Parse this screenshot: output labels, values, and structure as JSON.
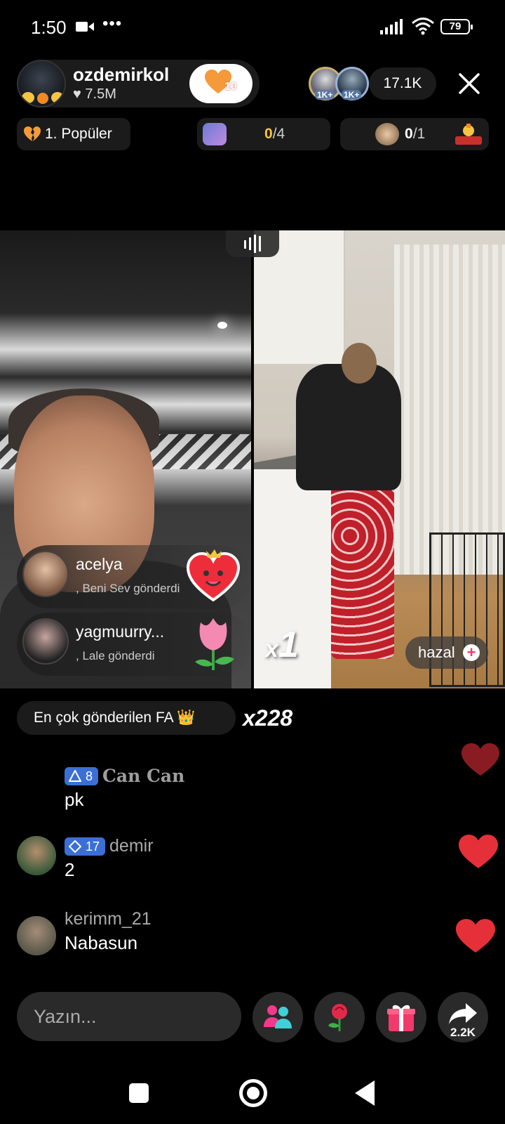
{
  "status_bar": {
    "time": "1:50",
    "more": "•••",
    "battery": "79"
  },
  "host": {
    "name": "ozdemirkol",
    "likes": "♥ 7.5M",
    "follow_badge": "10"
  },
  "top_viewers": {
    "badge1": "1K+",
    "badge2": "1K+",
    "count": "17.1K"
  },
  "popular": {
    "label": "1. Popüler"
  },
  "goals": [
    {
      "current": "0",
      "total": "/4"
    },
    {
      "current": "0",
      "total": "/1"
    }
  ],
  "gift_notices": [
    {
      "user": "acelya",
      "message": ", Beni Sev  gönderdi"
    },
    {
      "user": "yagmuurry...",
      "message": ", Lale  gönderdi"
    }
  ],
  "multiplier": {
    "prefix": "x",
    "value": "1"
  },
  "guest": {
    "name": "hazal"
  },
  "top_gift": {
    "label": "En çok gönderilen FA 👑",
    "count": "x228"
  },
  "chat": [
    {
      "level": "8",
      "user": "Can Can",
      "text": "pk"
    },
    {
      "level": "17",
      "user": "demir",
      "text": "2"
    },
    {
      "level": "",
      "user": "kerimm_21",
      "text": "Nabasun"
    }
  ],
  "bottom": {
    "input_placeholder": "Yazın...",
    "share_count": "2.2K"
  },
  "colors": {
    "accent_pink": "#f23a6a",
    "heart_red": "#e5303a",
    "level_blue": "#3b6fd6",
    "gold": "#f5c542"
  }
}
